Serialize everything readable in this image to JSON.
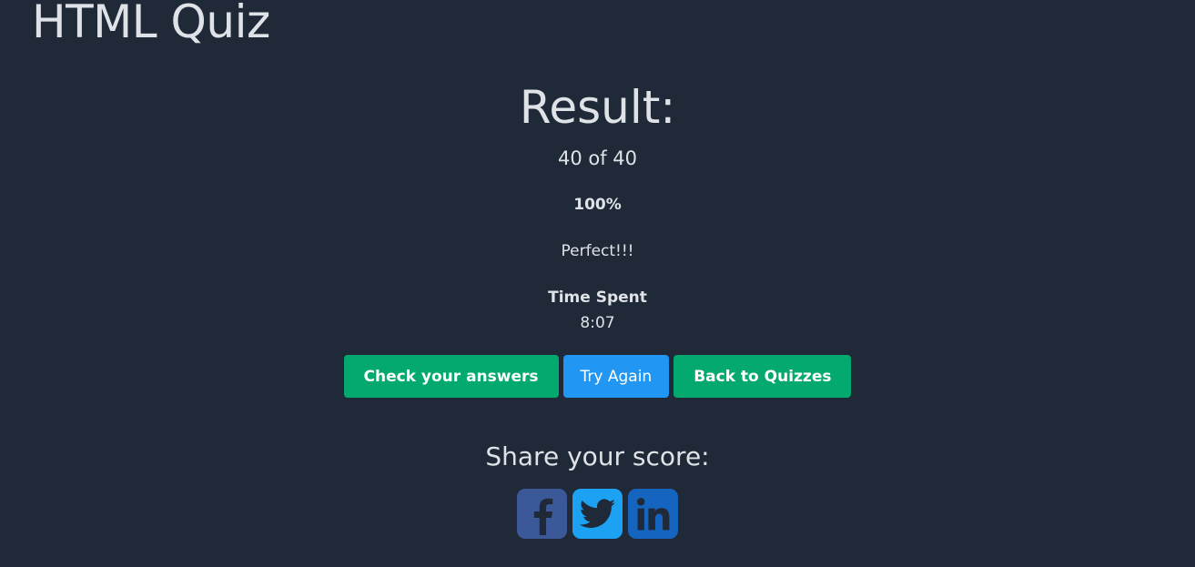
{
  "page": {
    "title": "HTML Quiz"
  },
  "result": {
    "heading": "Result:",
    "score": "40 of 40",
    "percent": "100%",
    "feedback": "Perfect!!!",
    "time_label": "Time Spent",
    "time_value": "8:07"
  },
  "buttons": {
    "check_answers": "Check your answers",
    "try_again": "Try Again",
    "back_to_quizzes": "Back to Quizzes"
  },
  "share": {
    "heading": "Share your score:",
    "networks": [
      {
        "name": "facebook",
        "icon": "facebook-icon",
        "color": "#3b5998"
      },
      {
        "name": "twitter",
        "icon": "twitter-icon",
        "color": "#1da1f2"
      },
      {
        "name": "linkedin",
        "icon": "linkedin-icon",
        "color": "#1565c0"
      }
    ]
  },
  "colors": {
    "background": "#1f2937",
    "text": "#dfe3e8",
    "green_button": "#04aa6d",
    "blue_button": "#2196f3"
  }
}
